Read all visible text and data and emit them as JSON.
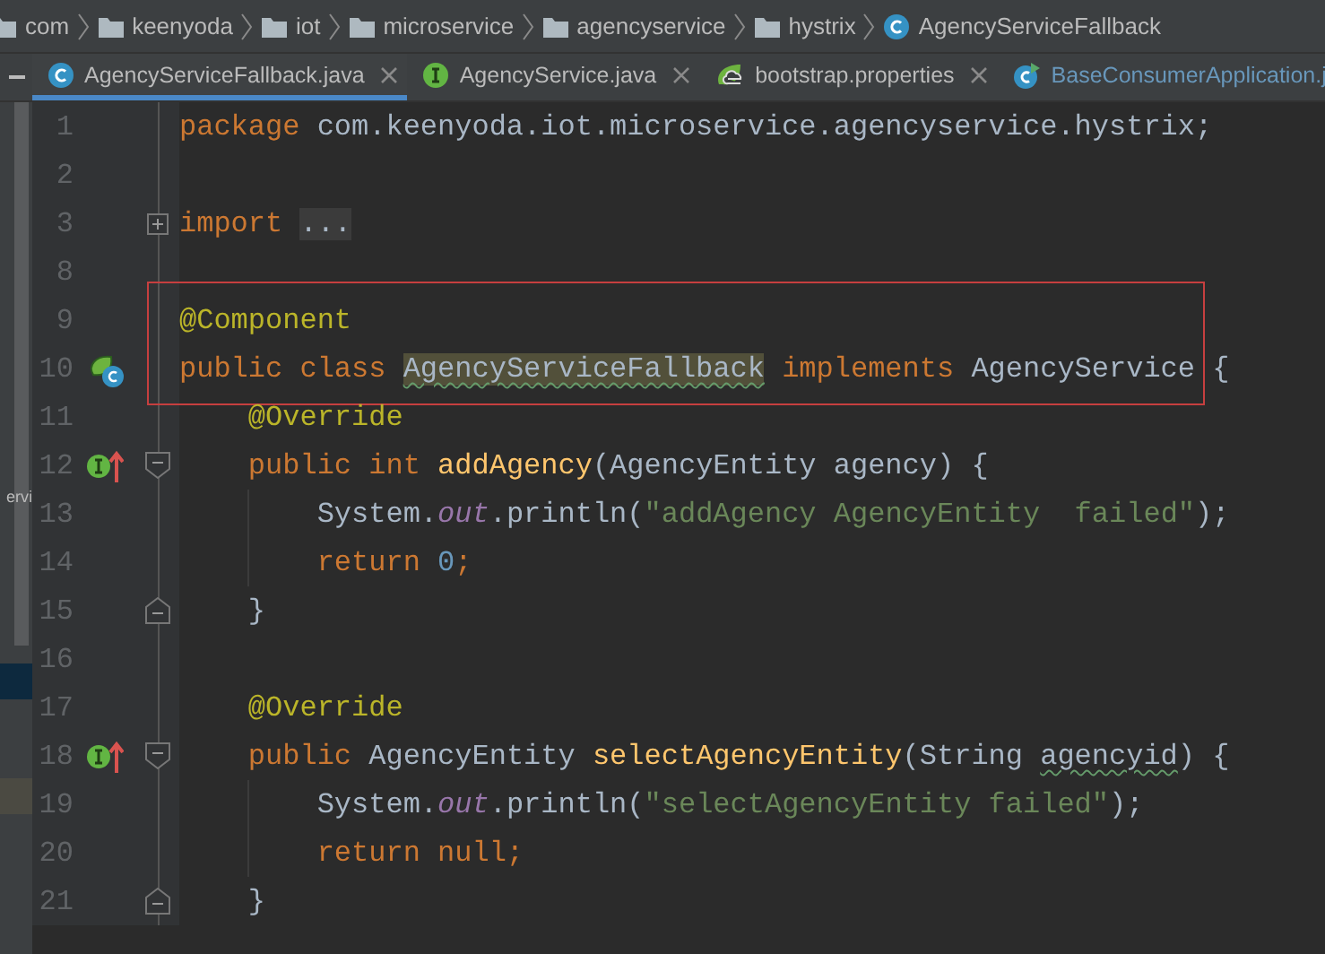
{
  "breadcrumb": [
    {
      "kind": "folder",
      "label": "com"
    },
    {
      "kind": "folder",
      "label": "keenyoda"
    },
    {
      "kind": "folder",
      "label": "iot"
    },
    {
      "kind": "folder",
      "label": "microservice"
    },
    {
      "kind": "folder",
      "label": "agencyservice"
    },
    {
      "kind": "folder",
      "label": "hystrix"
    },
    {
      "kind": "class",
      "label": "AgencyServiceFallback"
    }
  ],
  "tabs": [
    {
      "kind": "class",
      "label": "AgencyServiceFallback.java",
      "selected": true,
      "modified": false,
      "closable": true
    },
    {
      "kind": "interface",
      "label": "AgencyService.java",
      "selected": false,
      "modified": false,
      "closable": true
    },
    {
      "kind": "spring",
      "label": "bootstrap.properties",
      "selected": false,
      "modified": false,
      "closable": true
    },
    {
      "kind": "app",
      "label": "BaseConsumerApplication.j",
      "selected": false,
      "modified": true,
      "closable": false
    }
  ],
  "project_panel": {
    "items": [
      {
        "kind": "text",
        "text": "ervi"
      },
      {
        "kind": "row",
        "selected": true
      },
      {
        "kind": "inactive-row"
      }
    ]
  },
  "lines": [
    {
      "number": "1",
      "tokens": [
        {
          "kind": "kw",
          "text": "package "
        },
        {
          "kind": "plain",
          "text": "com.keenyoda.iot.microservice.agencyservice.hystrix;"
        }
      ]
    },
    {
      "number": "2"
    },
    {
      "number": "3",
      "fold": {
        "kind": "expand"
      },
      "tokens": [
        {
          "kind": "kw",
          "text": "import "
        },
        {
          "kind": "folded",
          "text": "..."
        }
      ]
    },
    {
      "number": "8"
    },
    {
      "number": "9",
      "framed": true,
      "tokens": [
        {
          "kind": "ann",
          "text": "@Component"
        }
      ]
    },
    {
      "number": "10",
      "framed": true,
      "gutter_icon": {
        "kind": "spring-class"
      },
      "tokens": [
        {
          "kind": "kw",
          "text": "public class "
        },
        {
          "kind": "plain",
          "text": "AgencyServiceFallback",
          "highlighted": true,
          "typo": true
        },
        {
          "kind": "kw",
          "text": " implements "
        },
        {
          "kind": "plain",
          "text": "AgencyService {"
        }
      ]
    },
    {
      "number": "11",
      "tokens": [
        {
          "kind": "ann",
          "text": "    @Override"
        }
      ]
    },
    {
      "number": "12",
      "gutter_icon": {
        "kind": "implements"
      },
      "fold": {
        "kind": "start"
      },
      "tokens": [
        {
          "kind": "kw",
          "text": "    public int "
        },
        {
          "kind": "method",
          "text": "addAgency"
        },
        {
          "kind": "plain",
          "text": "(AgencyEntity agency) {"
        }
      ]
    },
    {
      "number": "13",
      "tokens": [
        {
          "kind": "plain",
          "text": "        System."
        },
        {
          "kind": "field",
          "text": "out"
        },
        {
          "kind": "plain",
          "text": ".println("
        },
        {
          "kind": "str",
          "text": "\"addAgency AgencyEntity  failed\""
        },
        {
          "kind": "plain",
          "text": ");"
        }
      ]
    },
    {
      "number": "14",
      "tokens": [
        {
          "kind": "kw",
          "text": "        return "
        },
        {
          "kind": "num",
          "text": "0"
        },
        {
          "kind": "kw",
          "text": ";"
        }
      ]
    },
    {
      "number": "15",
      "fold": {
        "kind": "end"
      },
      "tokens": [
        {
          "kind": "plain",
          "text": "    }"
        }
      ]
    },
    {
      "number": "16"
    },
    {
      "number": "17",
      "tokens": [
        {
          "kind": "ann",
          "text": "    @Override"
        }
      ]
    },
    {
      "number": "18",
      "gutter_icon": {
        "kind": "implements"
      },
      "fold": {
        "kind": "start"
      },
      "tokens": [
        {
          "kind": "kw",
          "text": "    public "
        },
        {
          "kind": "plain",
          "text": "AgencyEntity "
        },
        {
          "kind": "method",
          "text": "selectAgencyEntity"
        },
        {
          "kind": "plain",
          "text": "(String "
        },
        {
          "kind": "plain",
          "text": "agencyid",
          "typo": true
        },
        {
          "kind": "plain",
          "text": ") {"
        }
      ]
    },
    {
      "number": "19",
      "tokens": [
        {
          "kind": "plain",
          "text": "        System."
        },
        {
          "kind": "field",
          "text": "out"
        },
        {
          "kind": "plain",
          "text": ".println("
        },
        {
          "kind": "str",
          "text": "\"selectAgencyEntity failed\""
        },
        {
          "kind": "plain",
          "text": ");"
        }
      ]
    },
    {
      "number": "20",
      "tokens": [
        {
          "kind": "kw",
          "text": "        return null;"
        }
      ]
    },
    {
      "number": "21",
      "fold": {
        "kind": "end"
      },
      "tokens": [
        {
          "kind": "plain",
          "text": "    }"
        }
      ]
    }
  ]
}
